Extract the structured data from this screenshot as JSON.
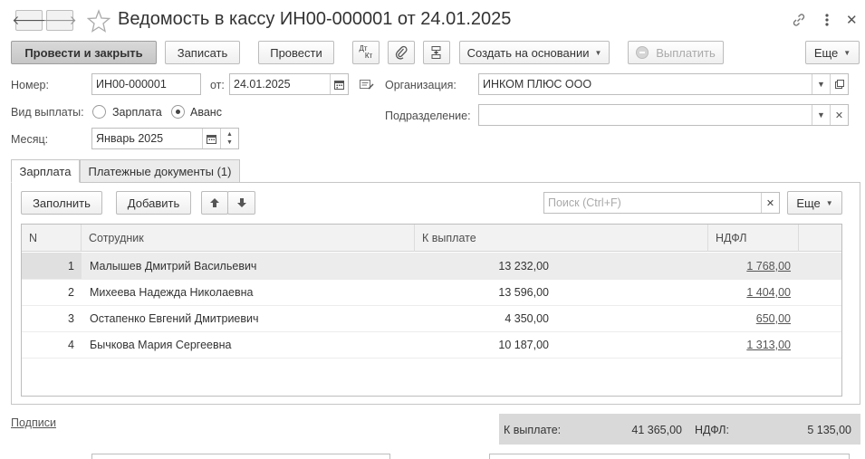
{
  "window": {
    "title": "Ведомость в кассу ИН00-000001 от 24.01.2025",
    "back_glyph": "🡐",
    "forward_glyph": "🡒"
  },
  "toolbar": {
    "post_close": "Провести и закрыть",
    "save": "Записать",
    "post": "Провести",
    "dtkt_top": "Дт",
    "dtkt_bottom": "Кт",
    "create_based": "Создать на основании",
    "pay": "Выплатить",
    "more": "Еще"
  },
  "form": {
    "number_label": "Номер:",
    "number_value": "ИН00-000001",
    "date_label": "от:",
    "date_value": "24.01.2025",
    "org_label": "Организация:",
    "org_value": "ИНКОМ ПЛЮС ООО",
    "paytype_label": "Вид выплаты:",
    "paytype_options": [
      "Зарплата",
      "Аванс"
    ],
    "paytype_selected": "Аванс",
    "division_label": "Подразделение:",
    "division_value": "",
    "month_label": "Месяц:",
    "month_value": "Январь 2025"
  },
  "tabs": [
    {
      "label": "Зарплата",
      "active": true
    },
    {
      "label": "Платежные документы (1)",
      "active": false
    }
  ],
  "table_toolbar": {
    "fill": "Заполнить",
    "add": "Добавить",
    "search_placeholder": "Поиск (Ctrl+F)",
    "more": "Еще"
  },
  "table": {
    "columns": [
      "N",
      "Сотрудник",
      "К выплате",
      "НДФЛ"
    ],
    "rows": [
      {
        "n": "1",
        "employee": "Малышев Дмитрий Васильевич",
        "amount": "13 232,00",
        "ndfl": "1 768,00"
      },
      {
        "n": "2",
        "employee": "Михеева Надежда Николаевна",
        "amount": "13 596,00",
        "ndfl": "1 404,00"
      },
      {
        "n": "3",
        "employee": "Остапенко Евгений Дмитриевич",
        "amount": "4 350,00",
        "ndfl": "650,00"
      },
      {
        "n": "4",
        "employee": "Бычкова Мария Сергеевна",
        "amount": "10 187,00",
        "ndfl": "1 313,00"
      }
    ]
  },
  "footer": {
    "signatures_link": "Подписи",
    "total_label": "К выплате:",
    "total_value": "41 365,00",
    "ndfl_label": "НДФЛ:",
    "ndfl_value": "5 135,00"
  },
  "colors": {
    "selected_row": "#e8e8e8",
    "header_bg": "#f2f2f2",
    "totals_bg": "#d9d9d9"
  }
}
